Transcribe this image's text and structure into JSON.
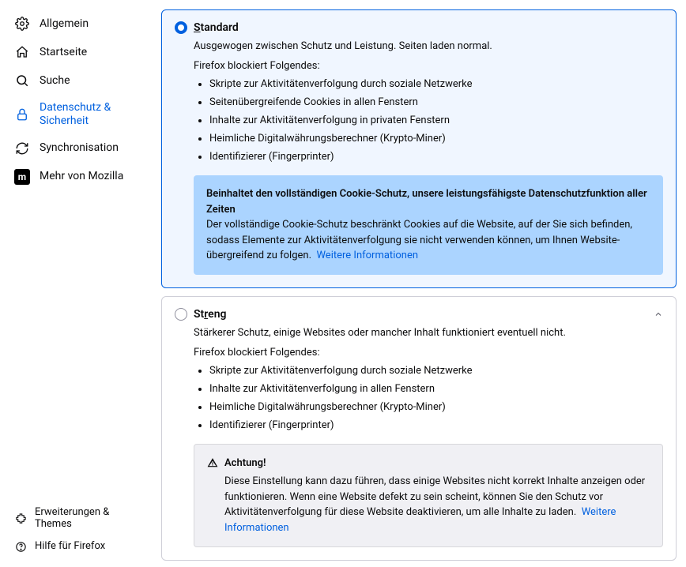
{
  "sidebar": {
    "items": [
      {
        "label": "Allgemein"
      },
      {
        "label": "Startseite"
      },
      {
        "label": "Suche"
      },
      {
        "label": "Datenschutz & Sicherheit"
      },
      {
        "label": "Synchronisation"
      },
      {
        "label": "Mehr von Mozilla"
      }
    ],
    "bottom": [
      {
        "label": "Erweiterungen & Themes"
      },
      {
        "label": "Hilfe für Firefox"
      }
    ]
  },
  "standard": {
    "title_prefix": "S",
    "title_rest": "tandard",
    "desc": "Ausgewogen zwischen Schutz und Leistung. Seiten laden normal.",
    "blocks_label": "Firefox blockiert Folgendes:",
    "items": [
      "Skripte zur Aktivitätenverfolgung durch soziale Netzwerke",
      "Seitenübergreifende Cookies in allen Fenstern",
      "Inhalte zur Aktivitätenverfolgung in privaten Fenstern",
      "Heimliche Digitalwährungsberechner (Krypto-Miner)",
      "Identifizierer (Fingerprinter)"
    ],
    "callout_title": "Beinhaltet den vollständigen Cookie-Schutz, unsere leistungsfähigste Datenschutzfunktion aller Zeiten",
    "callout_text": "Der vollständige Cookie-Schutz beschränkt Cookies auf die Website, auf der Sie sich befinden, sodass Elemente zur Aktivitätenverfolgung sie nicht verwenden können, um Ihnen Website-übergreifend zu folgen.",
    "learn_more": "Weitere Informationen"
  },
  "strict": {
    "title_prefix": "St",
    "title_accesskey": "r",
    "title_rest": "eng",
    "desc": "Stärkerer Schutz, einige Websites oder mancher Inhalt funktioniert eventuell nicht.",
    "blocks_label": "Firefox blockiert Folgendes:",
    "items": [
      "Skripte zur Aktivitätenverfolgung durch soziale Netzwerke",
      "Inhalte zur Aktivitätenverfolgung in allen Fenstern",
      "Heimliche Digitalwährungsberechner (Krypto-Miner)",
      "Identifizierer (Fingerprinter)"
    ],
    "warn_title": "Achtung!",
    "warn_text": "Diese Einstellung kann dazu führen, dass einige Websites nicht korrekt Inhalte anzeigen oder funktionieren. Wenn eine Website defekt zu sein scheint, können Sie den Schutz vor Aktivitätenverfolgung für diese Website deaktivieren, um alle Inhalte zu laden.",
    "learn_more": "Weitere Informationen"
  }
}
